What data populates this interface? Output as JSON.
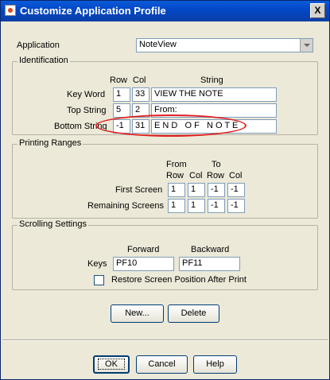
{
  "window": {
    "title": "Customize Application Profile",
    "close_glyph": "X"
  },
  "application": {
    "label": "Application",
    "value": "NoteView"
  },
  "identification": {
    "title": "Identification",
    "headers": {
      "row": "Row",
      "col": "Col",
      "string": "String"
    },
    "rows": [
      {
        "label": "Key Word",
        "row": "1",
        "col": "33",
        "string": "VIEW THE NOTE"
      },
      {
        "label": "Top String",
        "row": "5",
        "col": "2",
        "string": "From:"
      },
      {
        "label": "Bottom String",
        "row": "-1",
        "col": "31",
        "string": "E N D   O F   N O T E"
      }
    ]
  },
  "printing": {
    "title": "Printing Ranges",
    "headers": {
      "from": "From",
      "to": "To",
      "row": "Row",
      "col": "Col"
    },
    "rows": [
      {
        "label": "First Screen",
        "from_row": "1",
        "from_col": "1",
        "to_row": "-1",
        "to_col": "-1"
      },
      {
        "label": "Remaining Screens",
        "from_row": "1",
        "from_col": "1",
        "to_row": "-1",
        "to_col": "-1"
      }
    ]
  },
  "scrolling": {
    "title": "Scrolling Settings",
    "forward_header": "Forward",
    "backward_header": "Backward",
    "keys_label": "Keys",
    "forward": "PF10",
    "backward": "PF11",
    "restore_label": "Restore Screen Position After Print",
    "restore_checked": false
  },
  "actions": {
    "new": "New...",
    "delete": "Delete"
  },
  "footer": {
    "ok": "OK",
    "cancel": "Cancel",
    "help": "Help"
  },
  "colors": {
    "titlebar": "#0a5bd8",
    "highlight_ellipse": "#e02020",
    "panel": "#ece9d8"
  }
}
